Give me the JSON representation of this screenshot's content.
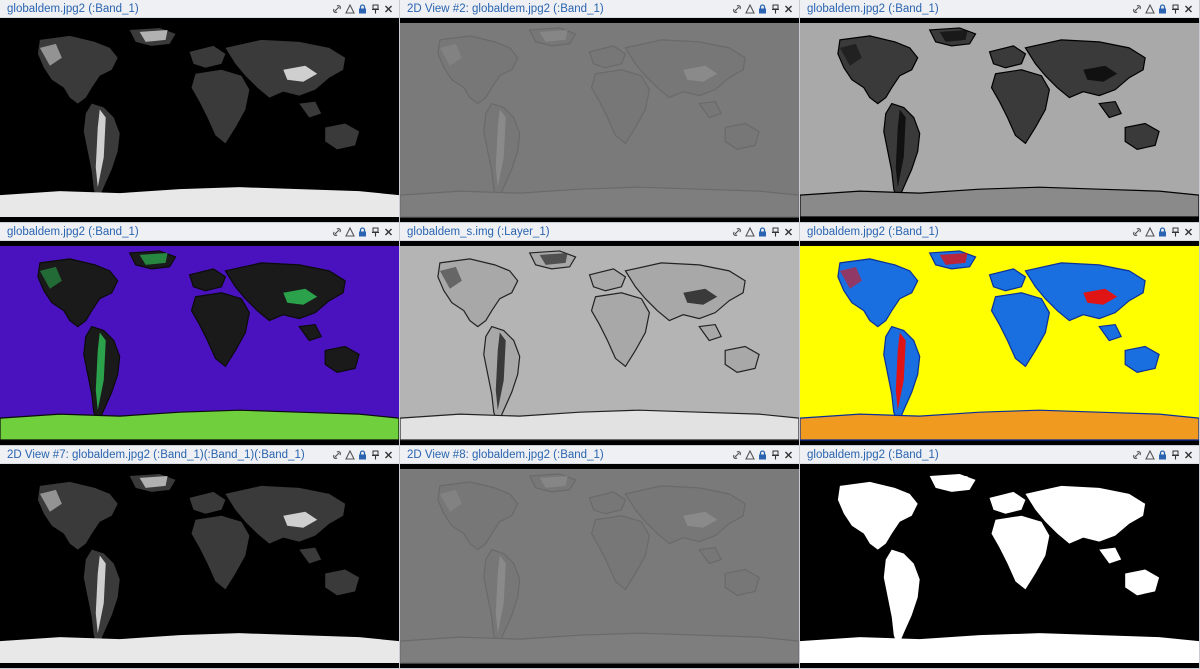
{
  "panels": [
    {
      "title": "globaldem.jpg2 (:Band_1)",
      "view": "gray-dem"
    },
    {
      "title": "2D View #2: globaldem.jpg2 (:Band_1)",
      "view": "emboss"
    },
    {
      "title": "globaldem.jpg2 (:Band_1)",
      "view": "edges"
    },
    {
      "title": "globaldem.jpg2 (:Band_1)",
      "view": "purple"
    },
    {
      "title": "globaldem_s.img (:Layer_1)",
      "view": "hillshade"
    },
    {
      "title": "globaldem.jpg2 (:Band_1)",
      "view": "rainbow"
    },
    {
      "title": "2D View #7: globaldem.jpg2 (:Band_1)(:Band_1)(:Band_1)",
      "view": "gray-dem"
    },
    {
      "title": "2D View #8: globaldem.jpg2 (:Band_1)",
      "view": "emboss"
    },
    {
      "title": "globaldem.jpg2 (:Band_1)",
      "view": "binary"
    }
  ],
  "toolbar_icons": [
    "link-icon",
    "triangle-icon",
    "lock-icon",
    "pin-icon",
    "close-icon"
  ]
}
